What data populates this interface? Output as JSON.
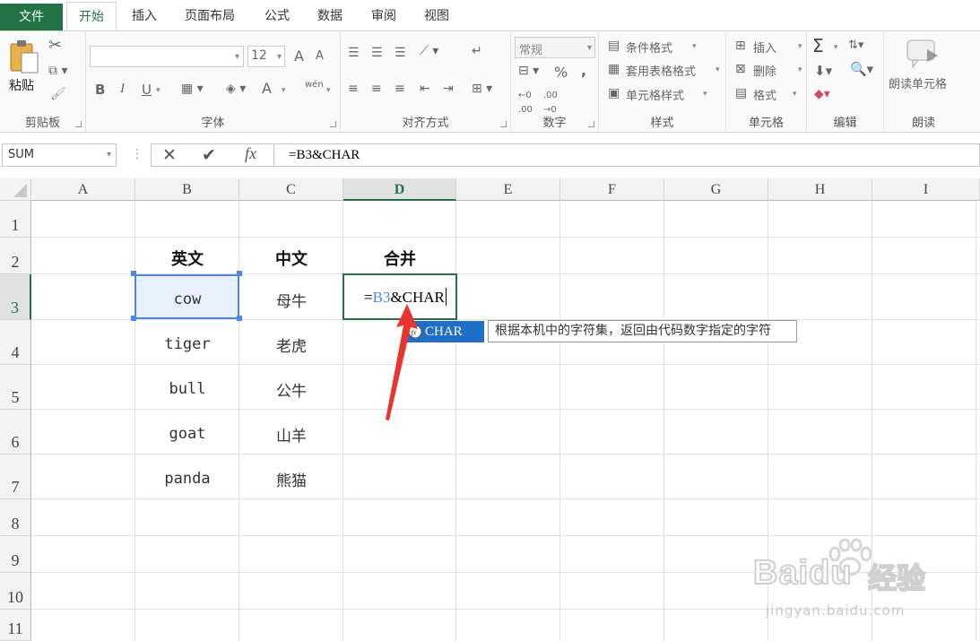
{
  "ribbon_tabs": [
    "文件",
    "开始",
    "插入",
    "页面布局",
    "公式",
    "数据",
    "审阅",
    "视图"
  ],
  "clipboard": {
    "paste_label": "粘贴",
    "group_label": "剪贴板"
  },
  "font": {
    "group_label": "字体",
    "size": "12",
    "bold": "B",
    "italic": "I",
    "underline": "U",
    "grow": "A",
    "shrink": "A",
    "color_a": "A",
    "pinyin": "wén"
  },
  "align": {
    "group_label": "对齐方式"
  },
  "number": {
    "group_label": "数字",
    "format": "常规",
    "percent": "%",
    "comma": ","
  },
  "styles": {
    "group_label": "样式",
    "conditional": "条件格式",
    "table": "套用表格格式",
    "cell": "单元格样式"
  },
  "cells": {
    "group_label": "单元格",
    "insert": "插入",
    "delete": "删除",
    "format": "格式"
  },
  "editing": {
    "group_label": "编辑",
    "sum": "Σ"
  },
  "reading": {
    "group_label": "朗读",
    "read_cell": "朗读单元格"
  },
  "formula_bar": {
    "name_box": "SUM",
    "cancel": "✕",
    "enter": "✔",
    "fx": "fx",
    "content": "=B3&CHAR"
  },
  "columns": [
    "A",
    "B",
    "C",
    "D",
    "E",
    "F",
    "G",
    "H",
    "I"
  ],
  "rows": [
    "1",
    "2",
    "3",
    "4",
    "5",
    "6",
    "7",
    "8",
    "9",
    "10",
    "11"
  ],
  "table": {
    "headers": [
      "英文",
      "中文",
      "合并"
    ],
    "english": [
      "cow",
      "tiger",
      "bull",
      "goat",
      "panda"
    ],
    "chinese": [
      "母牛",
      "老虎",
      "公牛",
      "山羊",
      "熊猫"
    ]
  },
  "edit_cell": {
    "prefix": "=",
    "ref": "B3",
    "suffix": "&CHAR"
  },
  "autocomplete": {
    "function": "CHAR",
    "tooltip": "根据本机中的字符集，返回由代码数字指定的字符"
  },
  "watermark": {
    "brand": "Baidu",
    "cn": "经验",
    "url": "jingyan.baidu.com"
  },
  "colors": {
    "excel_green": "#217346",
    "ref_blue": "#4a86e8",
    "highlight_blue": "#1e6fc5",
    "arrow_red": "#e8352e"
  }
}
